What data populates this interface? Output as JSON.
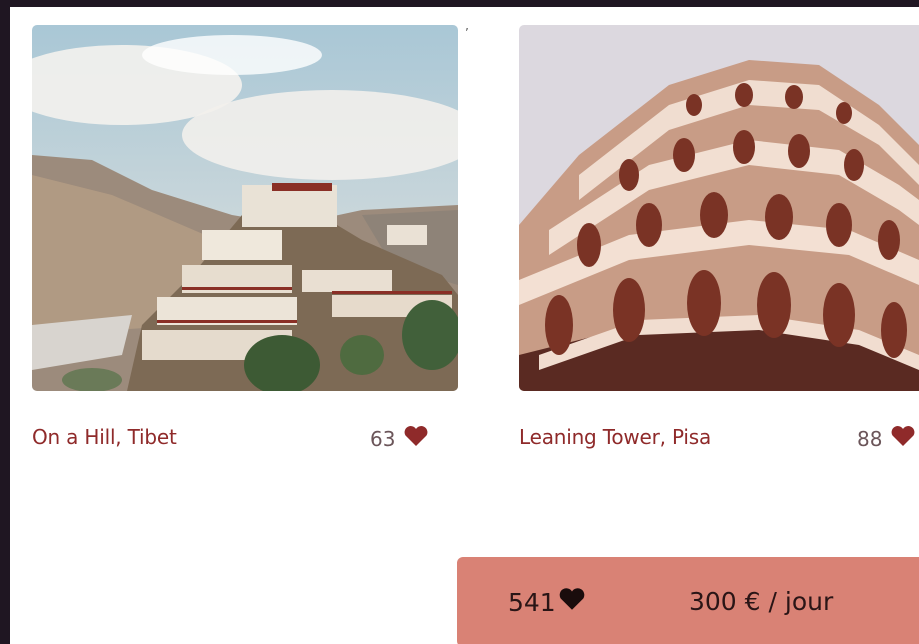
{
  "cards": [
    {
      "title": "On a Hill, Tibet",
      "likes": "63"
    },
    {
      "title": "Leaning Tower, Pisa",
      "likes": "88"
    }
  ],
  "footer": {
    "total_likes": "541",
    "price": "300 € / jour"
  },
  "colors": {
    "accent": "#8f2a2a",
    "bar": "#d98275",
    "frame": "#1f1622"
  }
}
